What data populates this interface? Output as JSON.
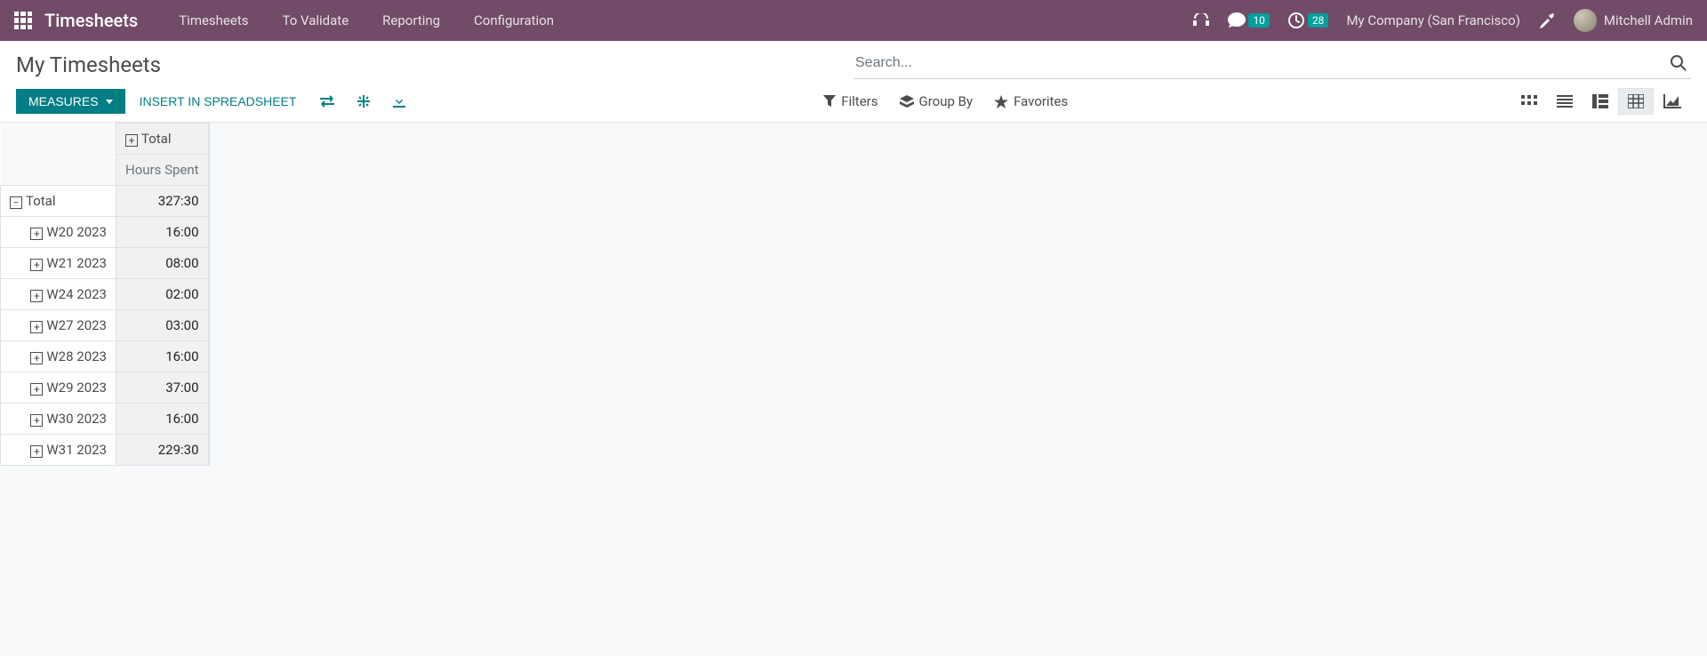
{
  "navbar": {
    "brand": "Timesheets",
    "menu": [
      "Timesheets",
      "To Validate",
      "Reporting",
      "Configuration"
    ],
    "messages_count": "10",
    "activities_count": "28",
    "company": "My Company (San Francisco)",
    "user": "Mitchell Admin"
  },
  "control_panel": {
    "breadcrumb": "My Timesheets",
    "search_placeholder": "Search...",
    "measures_btn": "Measures",
    "insert_btn": "Insert in Spreadsheet",
    "filters": "Filters",
    "group_by": "Group By",
    "favorites": "Favorites"
  },
  "pivot": {
    "col_total": "Total",
    "measure": "Hours Spent",
    "row_total_label": "Total",
    "row_total_value": "327:30",
    "rows": [
      {
        "label": "W20 2023",
        "value": "16:00"
      },
      {
        "label": "W21 2023",
        "value": "08:00"
      },
      {
        "label": "W24 2023",
        "value": "02:00"
      },
      {
        "label": "W27 2023",
        "value": "03:00"
      },
      {
        "label": "W28 2023",
        "value": "16:00"
      },
      {
        "label": "W29 2023",
        "value": "37:00"
      },
      {
        "label": "W30 2023",
        "value": "16:00"
      },
      {
        "label": "W31 2023",
        "value": "229:30"
      }
    ]
  }
}
